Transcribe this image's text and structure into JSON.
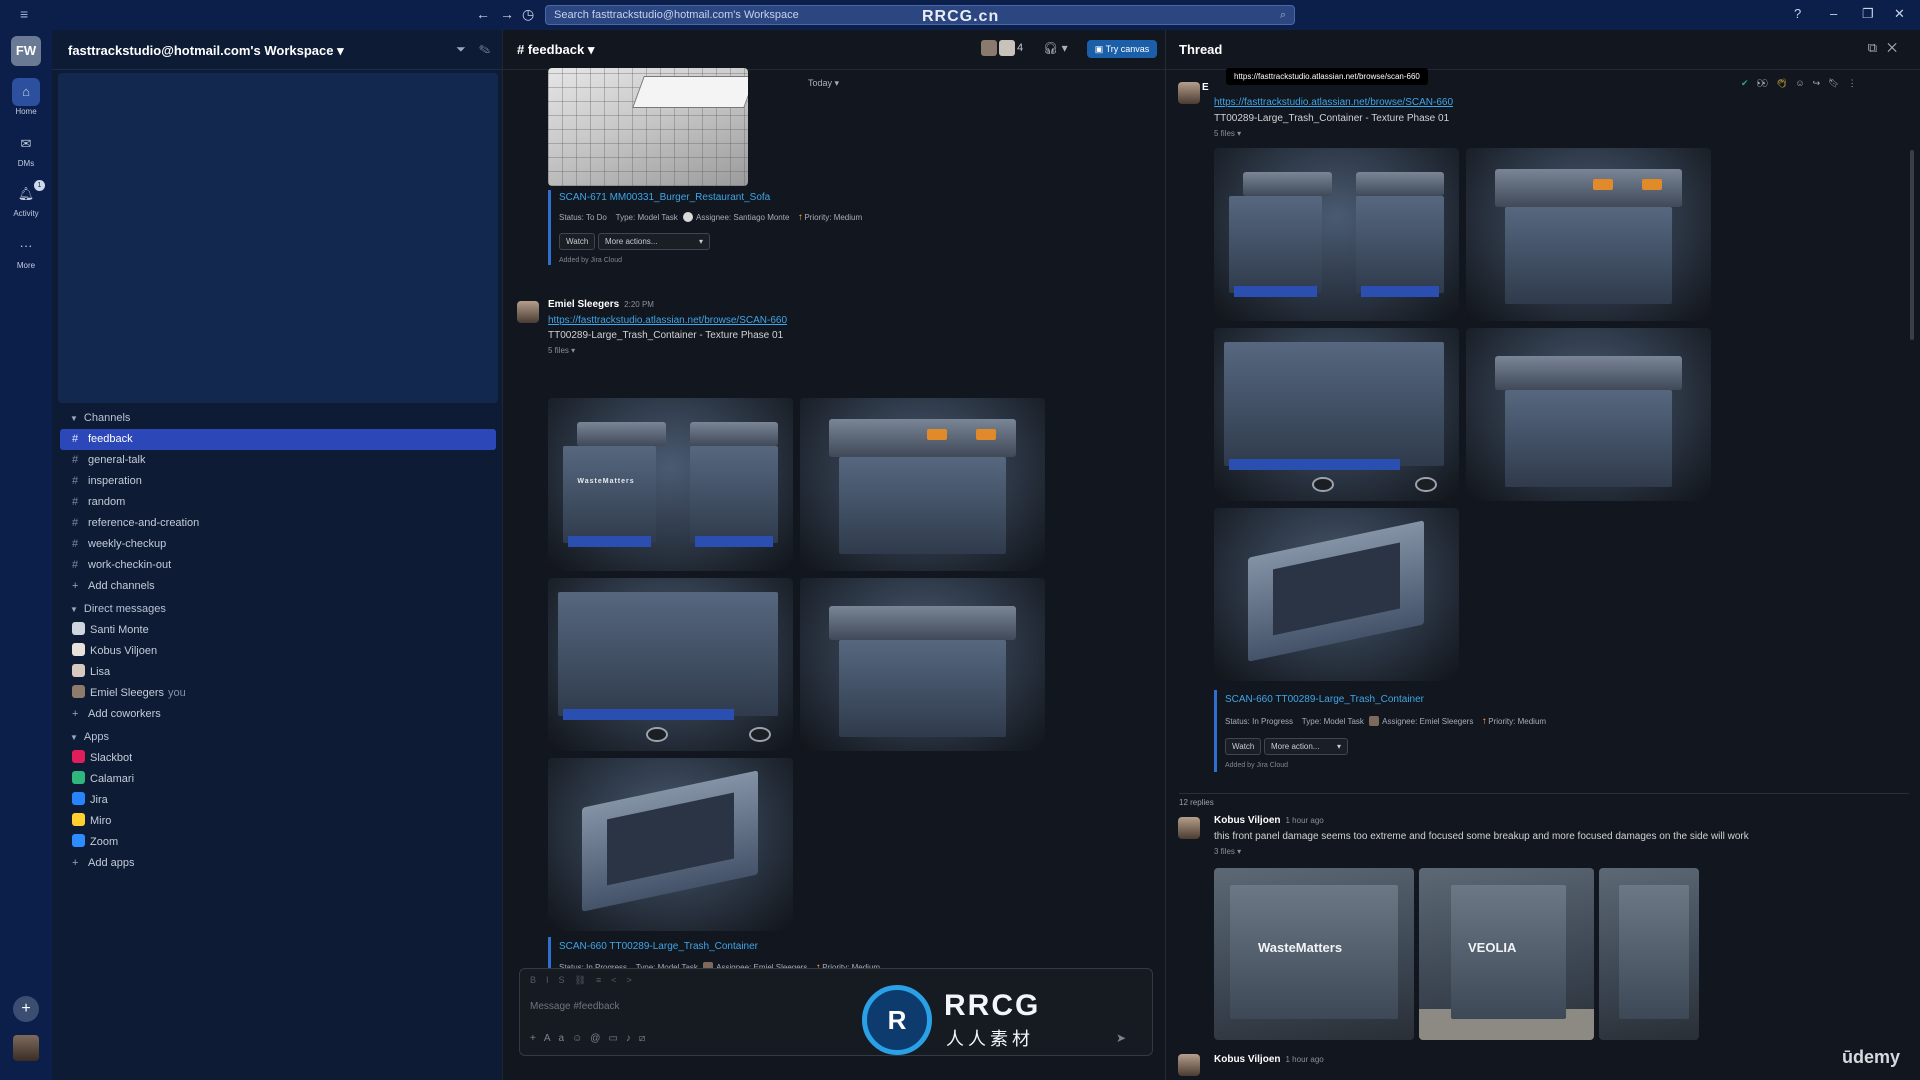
{
  "topbar": {
    "search_placeholder": "Search fasttrackstudio@hotmail.com's Workspace",
    "watermark": "RRCG.cn"
  },
  "rail": {
    "workspace_initials": "FW",
    "items": [
      {
        "label": "Home",
        "icon": "home-icon"
      },
      {
        "label": "DMs",
        "icon": "dm-icon"
      },
      {
        "label": "Activity",
        "icon": "bell-icon",
        "badge": "1"
      },
      {
        "label": "More",
        "icon": "more-icon"
      }
    ]
  },
  "sidebar": {
    "workspace_title": "fasttrackstudio@hotmail.com's Workspace",
    "channels_header": "Channels",
    "channels": [
      {
        "name": "feedback",
        "active": true
      },
      {
        "name": "general-talk"
      },
      {
        "name": "insperation"
      },
      {
        "name": "random"
      },
      {
        "name": "reference-and-creation"
      },
      {
        "name": "weekly-checkup"
      },
      {
        "name": "work-checkin-out"
      }
    ],
    "add_channels": "Add channels",
    "dm_header": "Direct messages",
    "dms": [
      {
        "name": "Santi Monte",
        "you": ""
      },
      {
        "name": "Kobus Viljoen",
        "you": ""
      },
      {
        "name": "Lisa",
        "you": ""
      },
      {
        "name": "Emiel Sleegers",
        "you": "you"
      }
    ],
    "add_coworkers": "Add coworkers",
    "apps_header": "Apps",
    "apps": [
      {
        "name": "Slackbot",
        "color": "#e01e5a"
      },
      {
        "name": "Calamari",
        "color": "#2eb67d"
      },
      {
        "name": "Jira",
        "color": "#2684ff"
      },
      {
        "name": "Miro",
        "color": "#ffd02f"
      },
      {
        "name": "Zoom",
        "color": "#2d8cff"
      }
    ],
    "add_apps": "Add apps"
  },
  "channel": {
    "title": "# feedback",
    "member_count": "4",
    "canvas_button": "Try canvas",
    "today_label": "Today",
    "card1": {
      "issue": "SCAN-671 MM00331_Burger_Restaurant_Sofa",
      "status_label": "Status:",
      "status": "To Do",
      "type_label": "Type:",
      "type": "Model Task",
      "assignee_label": "Assignee:",
      "assignee": "Santiago Monte",
      "priority_label": "Priority:",
      "priority": "Medium",
      "watch": "Watch",
      "more_actions": "More actions...",
      "added_by": "Added by Jira Cloud"
    },
    "message": {
      "author": "Emiel Sleegers",
      "time": "2:20 PM",
      "link": "https://fasttrackstudio.atlassian.net/browse/SCAN-660",
      "text": "TT00289-Large_Trash_Container - Texture Phase 01",
      "files": "5 files"
    },
    "card2": {
      "issue": "SCAN-660 TT00289-Large_Trash_Container",
      "status_label": "Status:",
      "status": "In Progress",
      "type_label": "Type:",
      "type": "Model Task",
      "assignee_label": "Assignee:",
      "assignee": "Emiel Sleegers",
      "priority_label": "Priority:",
      "priority": "Medium"
    },
    "composer_placeholder": "Message #feedback"
  },
  "thread": {
    "title": "Thread",
    "tooltip": "https://fasttrackstudio.atlassian.net/browse/scan-660",
    "author_initial": "E",
    "link": "https://fasttrackstudio.atlassian.net/browse/SCAN-660",
    "text": "TT00289-Large_Trash_Container - Texture Phase 01",
    "files": "5 files",
    "card": {
      "issue": "SCAN-660 TT00289-Large_Trash_Container",
      "status_label": "Status:",
      "status": "In Progress",
      "type_label": "Type:",
      "type": "Model Task",
      "assignee_label": "Assignee:",
      "assignee": "Emiel Sleegers",
      "priority_label": "Priority:",
      "priority": "Medium",
      "watch": "Watch",
      "more_actions": "More action...",
      "added_by": "Added by Jira Cloud"
    },
    "reply_count": "12 replies",
    "reply1": {
      "author": "Kobus Viljoen",
      "time": "1 hour ago",
      "text": "this front panel damage seems too extreme and focused some breakup and more focused damages on the side will work",
      "files": "3 files",
      "photo_text_1": "WasteMatters",
      "photo_text_2": "VEOLIA"
    },
    "reply2": {
      "author": "Kobus Viljoen",
      "time": "1 hour ago"
    }
  },
  "render_labels": {
    "bin_brand": "WasteMatters"
  },
  "overlays": {
    "logo_big": "RRCG",
    "logo_small": "人人素材",
    "udemy": "ūdemy"
  }
}
